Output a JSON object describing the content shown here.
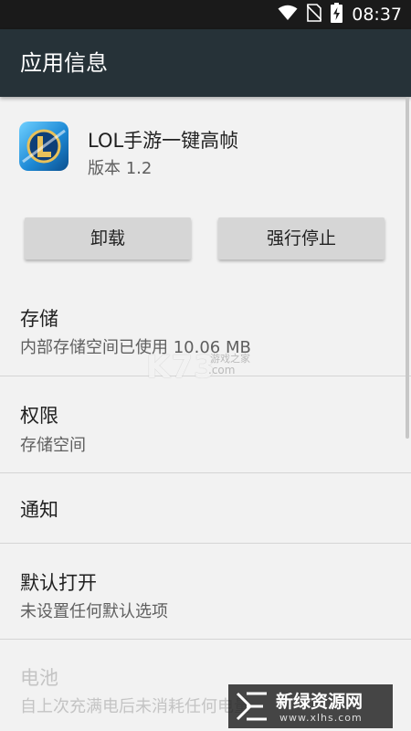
{
  "status_bar": {
    "time": "08:37",
    "icons": [
      "wifi-icon",
      "no-sim-icon",
      "battery-charging-icon"
    ]
  },
  "app_bar": {
    "title": "应用信息"
  },
  "app": {
    "name": "LOL手游一键高帧",
    "version": "版本 1.2",
    "icon": "league-of-legends-icon"
  },
  "buttons": {
    "uninstall": "卸载",
    "force_stop": "强行停止"
  },
  "sections": [
    {
      "title": "存储",
      "summary": "内部存储空间已使用 10.06 MB",
      "enabled": true
    },
    {
      "title": "权限",
      "summary": "存储空间",
      "enabled": true
    },
    {
      "title": "通知",
      "summary": "",
      "enabled": true
    },
    {
      "title": "默认打开",
      "summary": "未设置任何默认选项",
      "enabled": true
    },
    {
      "title": "电池",
      "summary": "自上次充满电后未消耗任何电量",
      "enabled": false
    }
  ],
  "watermarks": {
    "k73": {
      "logo": "K73",
      "sub": "游戏之家",
      "domain": ".com"
    },
    "xlhs": {
      "title": "新绿资源网",
      "url": "www.xlhs.com"
    }
  },
  "colors": {
    "app_bar": "#263238",
    "status_bar": "#1a1a1a",
    "background": "#f2f2f2",
    "button": "#d6d6d6"
  }
}
